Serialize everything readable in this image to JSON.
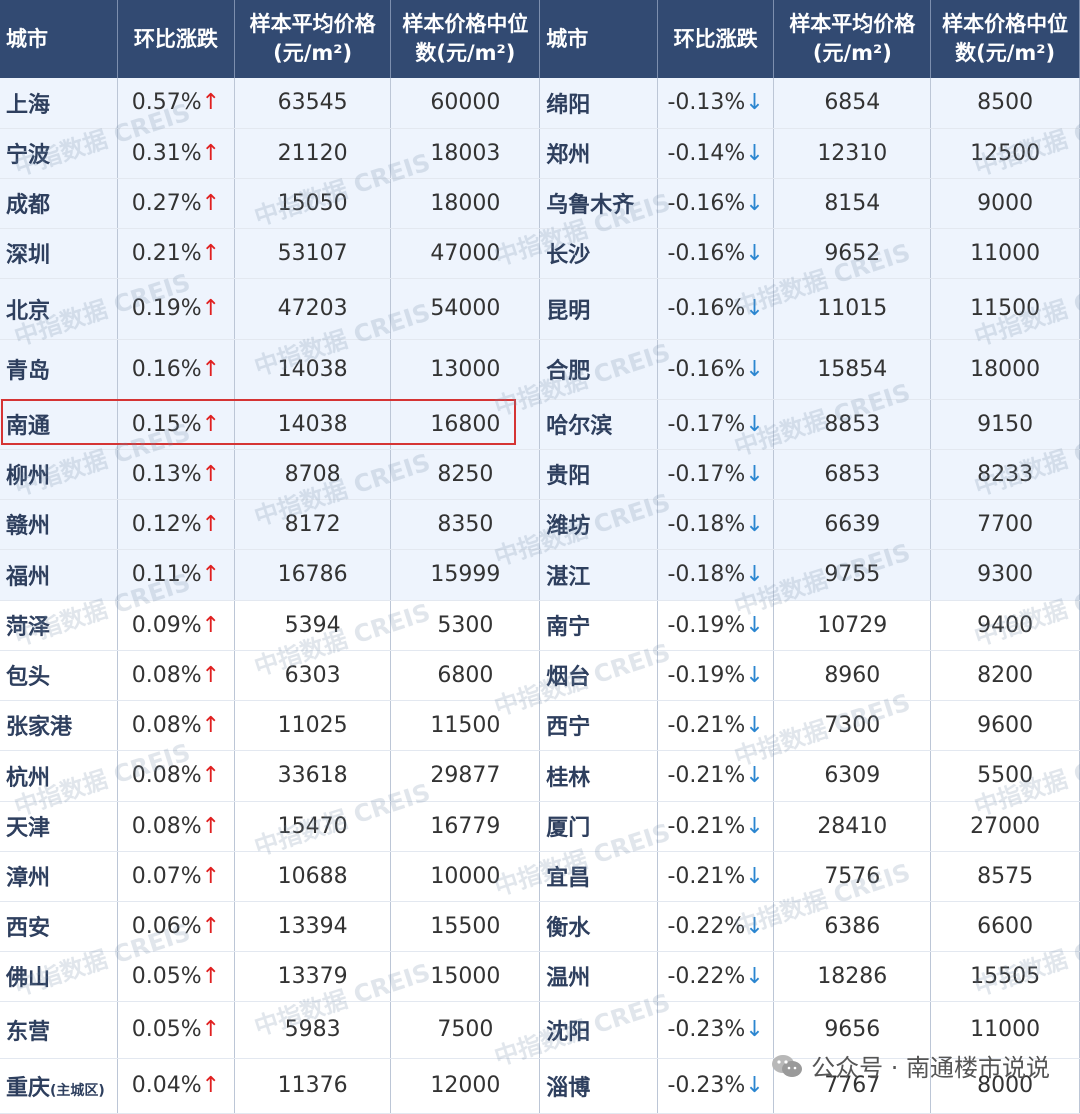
{
  "headers": [
    "城市",
    "环比涨跌",
    "样本平均价格(元/m²)",
    "样本价格中位数(元/m²)",
    "城市",
    "环比涨跌",
    "样本平均价格(元/m²)",
    "样本价格中位数(元/m²)"
  ],
  "header_lines": [
    [
      "城市"
    ],
    [
      "环比涨跌"
    ],
    [
      "样本平均价格",
      "(元/m²)"
    ],
    [
      "样本价格中位",
      "数(元/m²)"
    ],
    [
      "城市"
    ],
    [
      "环比涨跌"
    ],
    [
      "样本平均价格",
      "(元/m²)"
    ],
    [
      "样本价格中位",
      "数(元/m²)"
    ]
  ],
  "arrows": {
    "up": "↑",
    "down": "↓"
  },
  "colors": {
    "header_bg": "#324a72",
    "up": "#e02020",
    "down": "#2b86d0",
    "top_rows_bg": "#eef4fd",
    "highlight_border": "#d53434"
  },
  "highlight_city": "南通",
  "watermark_text": "中指数据 CREIS",
  "account_label": "公众号 · 南通楼市说说",
  "chart_data": {
    "type": "table",
    "columns": [
      "城市",
      "环比涨跌",
      "样本平均价格(元/m²)",
      "样本价格中位数(元/m²)"
    ],
    "left": [
      {
        "city": "上海",
        "change": "0.57%",
        "avg": 63545,
        "median": 60000
      },
      {
        "city": "宁波",
        "change": "0.31%",
        "avg": 21120,
        "median": 18003
      },
      {
        "city": "成都",
        "change": "0.27%",
        "avg": 15050,
        "median": 18000
      },
      {
        "city": "深圳",
        "change": "0.21%",
        "avg": 53107,
        "median": 47000
      },
      {
        "city": "北京",
        "change": "0.19%",
        "avg": 47203,
        "median": 54000
      },
      {
        "city": "青岛",
        "change": "0.16%",
        "avg": 14038,
        "median": 13000
      },
      {
        "city": "南通",
        "change": "0.15%",
        "avg": 14038,
        "median": 16800
      },
      {
        "city": "柳州",
        "change": "0.13%",
        "avg": 8708,
        "median": 8250
      },
      {
        "city": "赣州",
        "change": "0.12%",
        "avg": 8172,
        "median": 8350
      },
      {
        "city": "福州",
        "change": "0.11%",
        "avg": 16786,
        "median": 15999
      },
      {
        "city": "菏泽",
        "change": "0.09%",
        "avg": 5394,
        "median": 5300
      },
      {
        "city": "包头",
        "change": "0.08%",
        "avg": 6303,
        "median": 6800
      },
      {
        "city": "张家港",
        "change": "0.08%",
        "avg": 11025,
        "median": 11500
      },
      {
        "city": "杭州",
        "change": "0.08%",
        "avg": 33618,
        "median": 29877
      },
      {
        "city": "天津",
        "change": "0.08%",
        "avg": 15470,
        "median": 16779
      },
      {
        "city": "漳州",
        "change": "0.07%",
        "avg": 10688,
        "median": 10000
      },
      {
        "city": "西安",
        "change": "0.06%",
        "avg": 13394,
        "median": 15500
      },
      {
        "city": "佛山",
        "change": "0.05%",
        "avg": 13379,
        "median": 15000
      },
      {
        "city": "东营",
        "change": "0.05%",
        "avg": 5983,
        "median": 7500
      },
      {
        "city": "重庆",
        "city_note": "(主城区)",
        "change": "0.04%",
        "avg": 11376,
        "median": 12000
      }
    ],
    "right": [
      {
        "city": "绵阳",
        "change": "-0.13%",
        "avg": 6854,
        "median": 8500
      },
      {
        "city": "郑州",
        "change": "-0.14%",
        "avg": 12310,
        "median": 12500
      },
      {
        "city": "乌鲁木齐",
        "change": "-0.16%",
        "avg": 8154,
        "median": 9000
      },
      {
        "city": "长沙",
        "change": "-0.16%",
        "avg": 9652,
        "median": 11000
      },
      {
        "city": "昆明",
        "change": "-0.16%",
        "avg": 11015,
        "median": 11500
      },
      {
        "city": "合肥",
        "change": "-0.16%",
        "avg": 15854,
        "median": 18000
      },
      {
        "city": "哈尔滨",
        "change": "-0.17%",
        "avg": 8853,
        "median": 9150
      },
      {
        "city": "贵阳",
        "change": "-0.17%",
        "avg": 6853,
        "median": 8233
      },
      {
        "city": "潍坊",
        "change": "-0.18%",
        "avg": 6639,
        "median": 7700
      },
      {
        "city": "湛江",
        "change": "-0.18%",
        "avg": 9755,
        "median": 9300
      },
      {
        "city": "南宁",
        "change": "-0.19%",
        "avg": 10729,
        "median": 9400
      },
      {
        "city": "烟台",
        "change": "-0.19%",
        "avg": 8960,
        "median": 8200
      },
      {
        "city": "西宁",
        "change": "-0.21%",
        "avg": 7300,
        "median": 9600
      },
      {
        "city": "桂林",
        "change": "-0.21%",
        "avg": 6309,
        "median": 5500
      },
      {
        "city": "厦门",
        "change": "-0.21%",
        "avg": 28410,
        "median": 27000
      },
      {
        "city": "宜昌",
        "change": "-0.21%",
        "avg": 7576,
        "median": 8575
      },
      {
        "city": "衡水",
        "change": "-0.22%",
        "avg": 6386,
        "median": 6600
      },
      {
        "city": "温州",
        "change": "-0.22%",
        "avg": 18286,
        "median": 15505
      },
      {
        "city": "沈阳",
        "change": "-0.23%",
        "avg": 9656,
        "median": 11000
      },
      {
        "city": "淄博",
        "change": "-0.23%",
        "avg": 7767,
        "median": 8000
      }
    ]
  }
}
